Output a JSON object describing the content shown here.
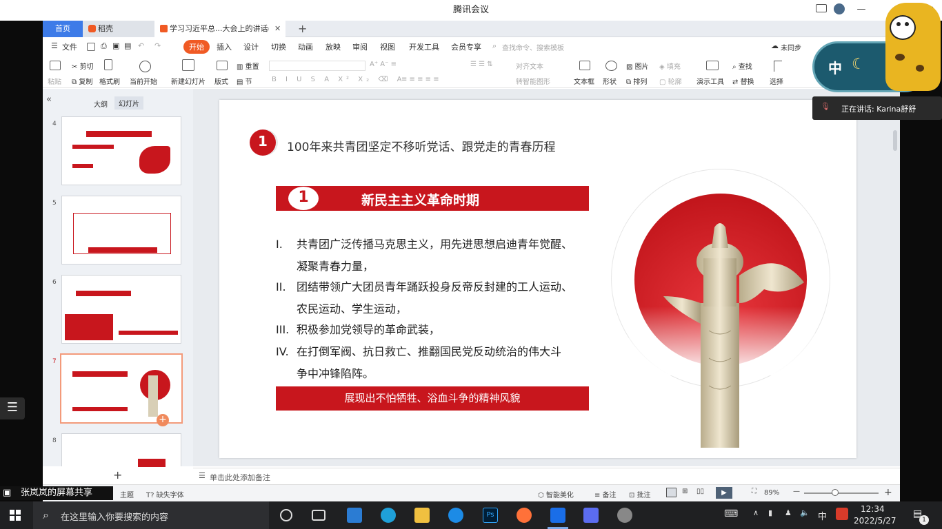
{
  "meeting": {
    "title": "腾讯会议",
    "speaking": "正在讲话: Karina舒舒",
    "share_label": "张岚岚的屏幕共享",
    "widget_text": "中"
  },
  "wps": {
    "tabs": {
      "home": "首页",
      "dao": "稻壳",
      "doc": "学习习近平总...大会上的讲话"
    },
    "menu": [
      "文件",
      "开始",
      "插入",
      "设计",
      "切换",
      "动画",
      "放映",
      "审阅",
      "视图",
      "开发工具",
      "会员专享"
    ],
    "search_placeholder": "查找命令、搜索模板",
    "sync": "未同步",
    "ribbon": {
      "paste": "粘贴",
      "cut": "剪切",
      "copy": "复制",
      "format": "格式刷",
      "from_current": "当前开始",
      "new_slide": "新建幻灯片",
      "layout": "版式",
      "reset": "重置",
      "section": "节",
      "align_text": "对齐文本",
      "smartart": "转智能图形",
      "textbox": "文本框",
      "shape": "形状",
      "picture": "图片",
      "arrange": "排列",
      "fill": "填充",
      "outline": "轮廓",
      "present_tool": "演示工具",
      "find": "查找",
      "replace": "替换",
      "select": "选择"
    },
    "panel_tabs": {
      "outline": "大纲",
      "slides": "幻灯片"
    },
    "slide_numbers": [
      "4",
      "5",
      "6",
      "7",
      "8"
    ],
    "notes_placeholder": "单击此处添加备注",
    "status": {
      "theme": "主题",
      "missing_font": "缺失字体",
      "beautify": "智能美化",
      "notes": "备注",
      "comment": "批注",
      "zoom": "89%"
    }
  },
  "slide": {
    "section_num": "1",
    "heading": "100年来共青团坚定不移听党话、跟党走的青春历程",
    "banner_num": "1",
    "banner_title": "新民主主义革命时期",
    "items": [
      {
        "num": "I.",
        "line1": "共青团广泛传播马克思主义，用先进思想启迪青年觉醒、",
        "line2": "凝聚青春力量，"
      },
      {
        "num": "II.",
        "line1": "团结带领广大团员青年踊跃投身反帝反封建的工人运动、",
        "line2": "农民运动、学生运动，"
      },
      {
        "num": "III.",
        "line1": "积极参加党领导的革命武装，",
        "line2": ""
      },
      {
        "num": "IV.",
        "line1": "在打倒军阀、抗日救亡、推翻国民党反动统治的伟大斗",
        "line2": "争中冲锋陷阵。"
      }
    ],
    "footer_banner": "展现出不怕牺牲、浴血斗争的精神风貌"
  },
  "taskbar": {
    "search_placeholder": "在这里输入你要搜索的内容",
    "time": "12:34",
    "date": "2022/5/27",
    "ime": "中",
    "notif_count": "1"
  },
  "colors": {
    "brand_red": "#c8161d",
    "wps_orange": "#f05a24"
  }
}
